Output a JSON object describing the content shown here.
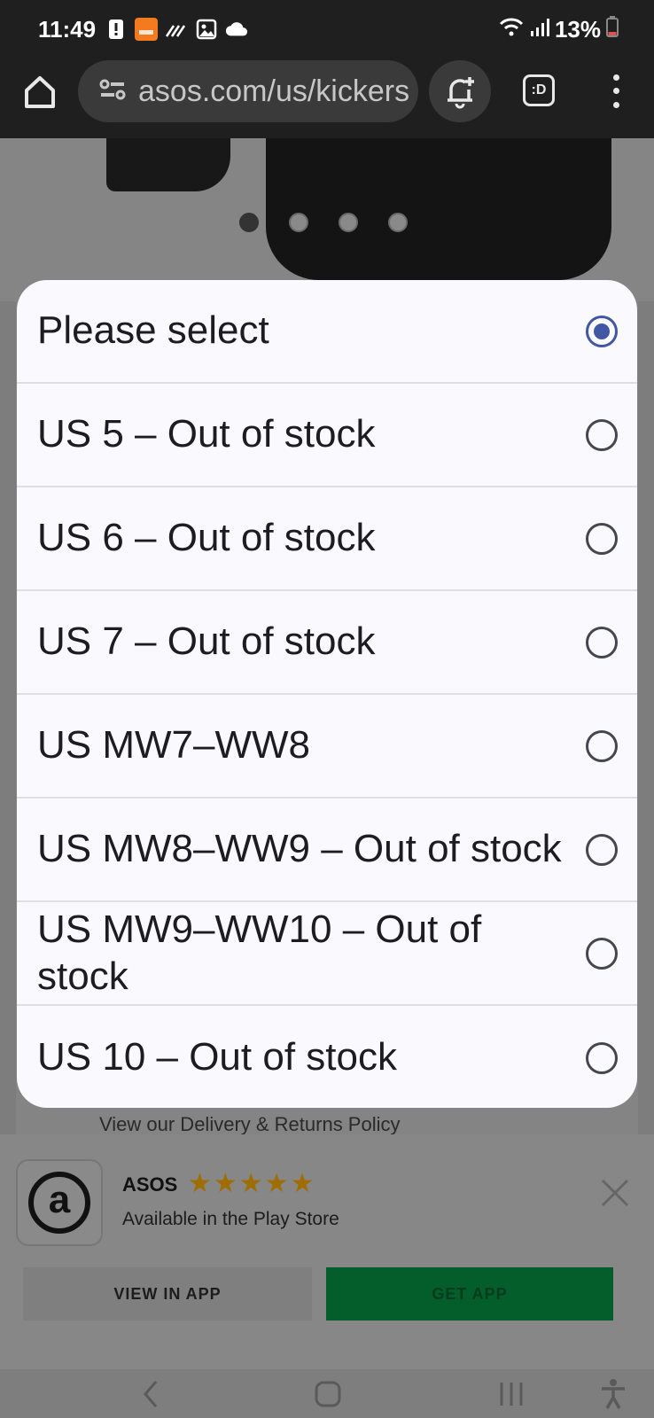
{
  "status_bar": {
    "time": "11:49",
    "battery": "13%"
  },
  "browser": {
    "url": "asos.com/us/kickers"
  },
  "page": {
    "delivery_link": "View our Delivery & Returns Policy"
  },
  "dropdown": {
    "options": [
      {
        "label": "Please select",
        "selected": true
      },
      {
        "label": "US 5 – Out of stock",
        "selected": false
      },
      {
        "label": "US 6 – Out of stock",
        "selected": false
      },
      {
        "label": "US 7 – Out of stock",
        "selected": false
      },
      {
        "label": "US MW7–WW8",
        "selected": false
      },
      {
        "label": "US MW8–WW9 – Out of stock",
        "selected": false
      },
      {
        "label": "US MW9–WW10 – Out of stock",
        "selected": false
      },
      {
        "label": "US 10 – Out of stock",
        "selected": false
      }
    ]
  },
  "app_banner": {
    "name": "ASOS",
    "stars": "★★★★★",
    "rating": 5,
    "subtitle": "Available in the Play Store",
    "view_button": "VIEW IN APP",
    "get_button": "GET APP"
  },
  "colors": {
    "accent": "#4257a4",
    "brand_green": "#035e2b",
    "toolbar": "#1f1f1f"
  }
}
